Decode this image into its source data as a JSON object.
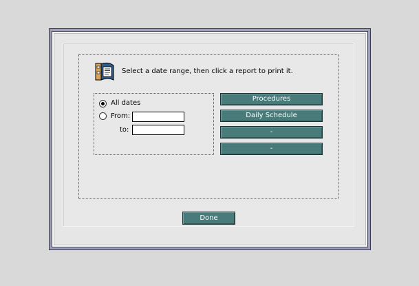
{
  "instruction": "Select a date range, then click a report to print it.",
  "date_range": {
    "options": [
      {
        "label": "All dates",
        "selected": true
      },
      {
        "label": "From:",
        "selected": false
      }
    ],
    "from_value": "",
    "to_label": "to:",
    "to_value": ""
  },
  "reports": [
    {
      "label": "Procedures"
    },
    {
      "label": "Daily Schedule"
    },
    {
      "label": "-"
    },
    {
      "label": "-"
    }
  ],
  "done_label": "Done",
  "icons": {
    "report": "report-print-icon"
  },
  "colors": {
    "button_bg": "#4a7b7b",
    "dialog_border": "#3a3a55",
    "desktop_bg": "#d9d9d9"
  }
}
